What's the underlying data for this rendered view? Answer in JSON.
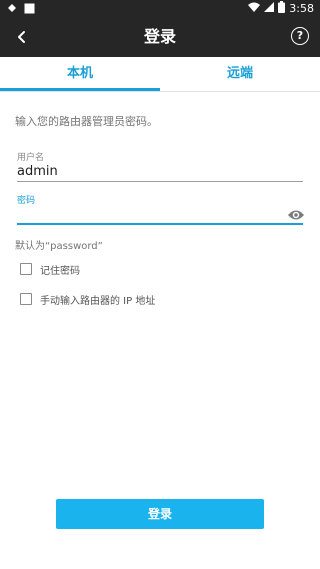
{
  "statusbar": {
    "time": "3:58",
    "left_icons": [
      "notification-icon",
      "square-icon"
    ],
    "right_icons": [
      "wifi-icon",
      "signal-icon",
      "battery-icon"
    ]
  },
  "appbar": {
    "title": "登录",
    "back_icon": "back-chevron-icon",
    "help_label": "?"
  },
  "tabs": [
    {
      "label": "本机",
      "active": true
    },
    {
      "label": "远端",
      "active": false
    }
  ],
  "form": {
    "instruction": "输入您的路由器管理员密码。",
    "username_label": "用户名",
    "username_value": "admin",
    "password_label": "密码",
    "password_value": "",
    "default_hint": "默认为“password”",
    "remember_label": "记住密码",
    "manual_ip_label": "手动输入路由器的 IP 地址"
  },
  "actions": {
    "login_label": "登录"
  },
  "colors": {
    "accent": "#1aa0d8",
    "button": "#1ab3ee",
    "bar": "#262626"
  }
}
